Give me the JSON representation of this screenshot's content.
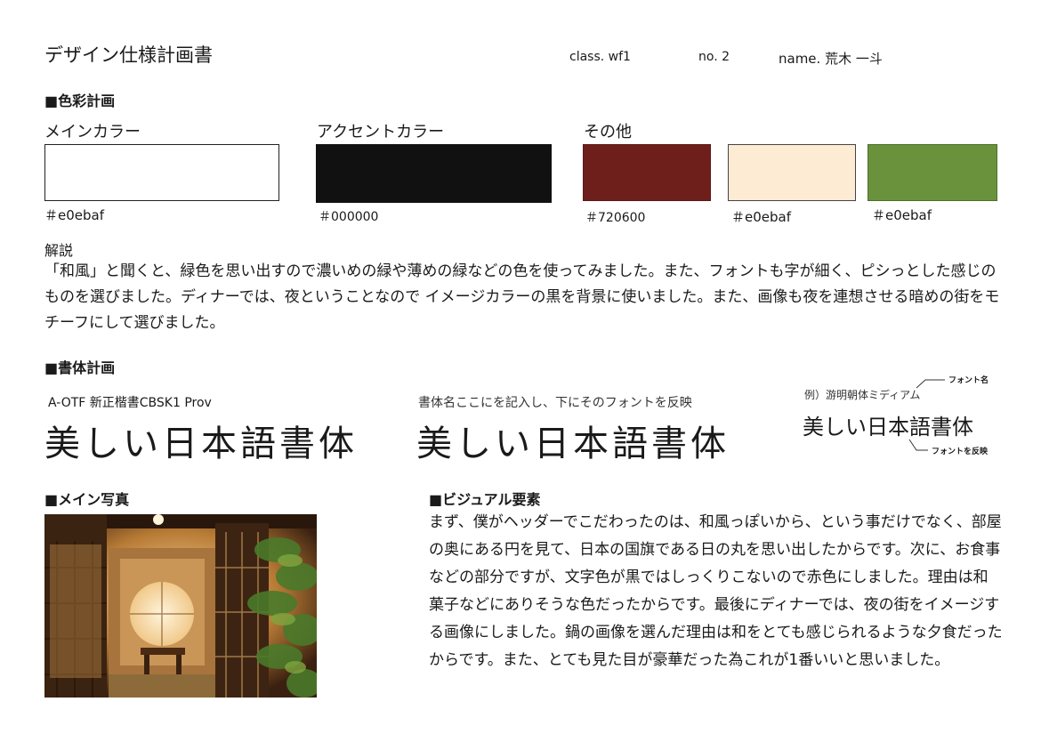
{
  "header": {
    "title": "デザイン仕様計画書",
    "class": "class.  wf1",
    "no": "no.  2",
    "name": "name. 荒木 一斗"
  },
  "color_plan": {
    "heading": "■色彩計画",
    "main_label": "メインカラー",
    "accent_label": "アクセントカラー",
    "other_label": "その他",
    "swatches": [
      {
        "code": "＃e0ebaf",
        "color": "#ffffff"
      },
      {
        "code": "＃000000",
        "color": "#111111"
      },
      {
        "code": "＃720600",
        "color": "#6e1f1c"
      },
      {
        "code": "＃e0ebaf",
        "color": "#fdebd3"
      },
      {
        "code": "＃e0ebaf",
        "color": "#6a923c"
      }
    ],
    "explanation_label": "解説",
    "explanation": "「和風」と聞くと、緑色を思い出すので濃いめの緑や薄めの緑などの色を使ってみました。また、フォントも字が細く、ピシっとした感じのものを選びました。ディナーでは、夜ということなので イメージカラーの黒を背景に使いました。また、画像も夜を連想させる暗めの街をモチーフにして選びました。"
  },
  "font_plan": {
    "heading": "■書体計画",
    "font1_name": "A-OTF 新正楷書CBSK1 Prov",
    "font1_sample": "美しい日本語書体",
    "font2_name": "書体名ここにを記入し、下にそのフォントを反映",
    "font2_sample": "美しい日本語書体",
    "example_label": "例）游明朝体ミディアム",
    "example_sample": "美しい日本語書体",
    "note_font_name": "フォント名",
    "note_reflect": "フォントを反映"
  },
  "main_photo": {
    "heading": "■メイン写真"
  },
  "visual": {
    "heading": "■ビジュアル要素",
    "body": "まず、僕がヘッダーでこだわったのは、和風っぽいから、という事だけでなく、部屋の奥にある円を見て、日本の国旗である日の丸を思い出したからです。次に、お食事などの部分ですが、文字色が黒ではしっくりこないので赤色にしました。理由は和菓子などにありそうな色だったからです。最後にディナーでは、夜の街をイメージする画像にしました。鍋の画像を選んだ理由は和をとても感じられるような夕食だったからです。また、とても見た目が豪華だった為これが1番いいと思いました。"
  }
}
